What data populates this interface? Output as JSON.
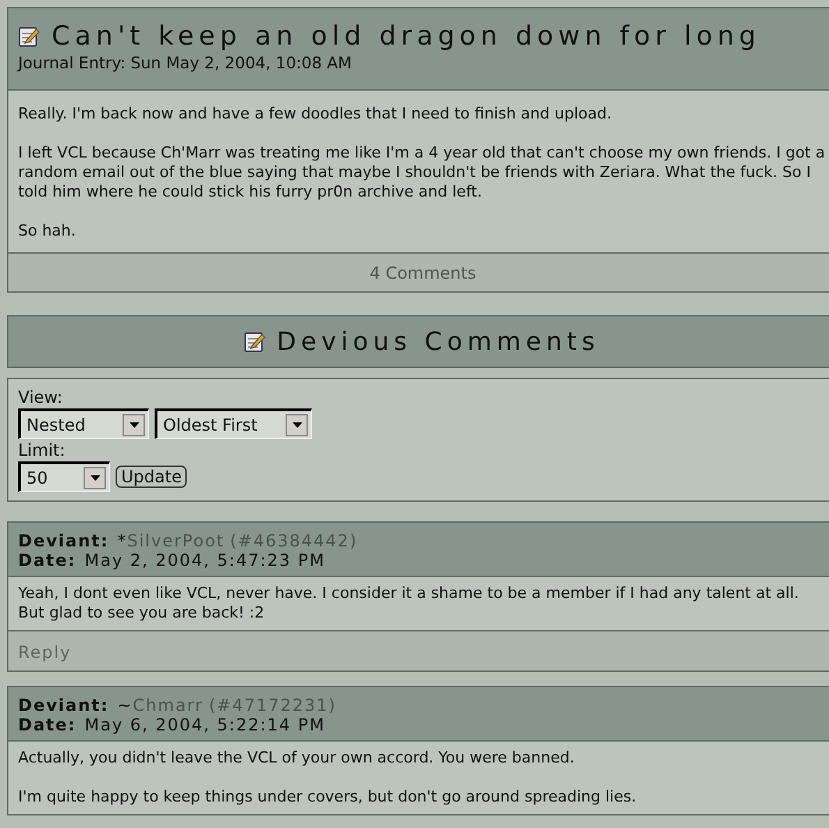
{
  "journal": {
    "title": "Can't keep an old dragon down for long",
    "subtitle": "Journal Entry: Sun May 2, 2004, 10:08 AM",
    "paragraphs": [
      "Really. I'm back now and have a few doodles that I need to finish and upload.",
      "I left VCL because Ch'Marr was treating me like I'm a 4 year old that can't choose my own friends. I got a random email out of the blue saying that maybe I shouldn't be friends with Zeriara. What the fuck. So I told him where he could stick his furry pr0n archive and left.",
      "So hah."
    ],
    "comments_link": "4 Comments"
  },
  "comments_section": {
    "title": "Devious Comments",
    "view_label": "View:",
    "view_select": "Nested",
    "order_select": "Oldest First",
    "limit_label": "Limit:",
    "limit_select": "50",
    "update_button": "Update"
  },
  "comments": [
    {
      "deviant_label": "Deviant:",
      "symbol": "*",
      "name": "SilverPoot",
      "id": "(#46384442)",
      "date_label": "Date:",
      "date": "May 2, 2004, 5:47:23 PM",
      "paragraphs": [
        "Yeah, I dont even like VCL, never have. I consider it a shame to be a member if I had any talent at all. But glad to see you are back! :2"
      ],
      "reply": "Reply"
    },
    {
      "deviant_label": "Deviant:",
      "symbol": "~",
      "name": "Chmarr",
      "id": "(#47172231)",
      "date_label": "Date:",
      "date": "May 6, 2004, 5:22:14 PM",
      "paragraphs": [
        "Actually, you didn't leave the VCL of your own accord. You were banned.",
        "I'm quite happy to keep things under covers, but don't go around spreading lies."
      ]
    }
  ]
}
